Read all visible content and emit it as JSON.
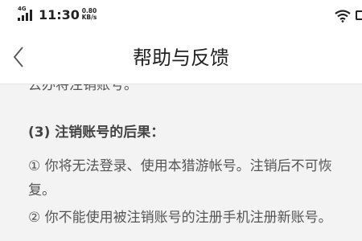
{
  "status_bar": {
    "network": "4G",
    "time": "11:30",
    "speed_value": "0.80",
    "speed_unit": "KB/s"
  },
  "nav": {
    "title": "帮助与反馈"
  },
  "article": {
    "cut_off_line": "去办将注销账号。",
    "heading": "(3) 注销账号的后果：",
    "items": [
      "① 你将无法登录、使用本猎游帐号。注销后不可恢复。",
      "② 你不能使用被注销账号的注册手机注册新账号。"
    ]
  }
}
